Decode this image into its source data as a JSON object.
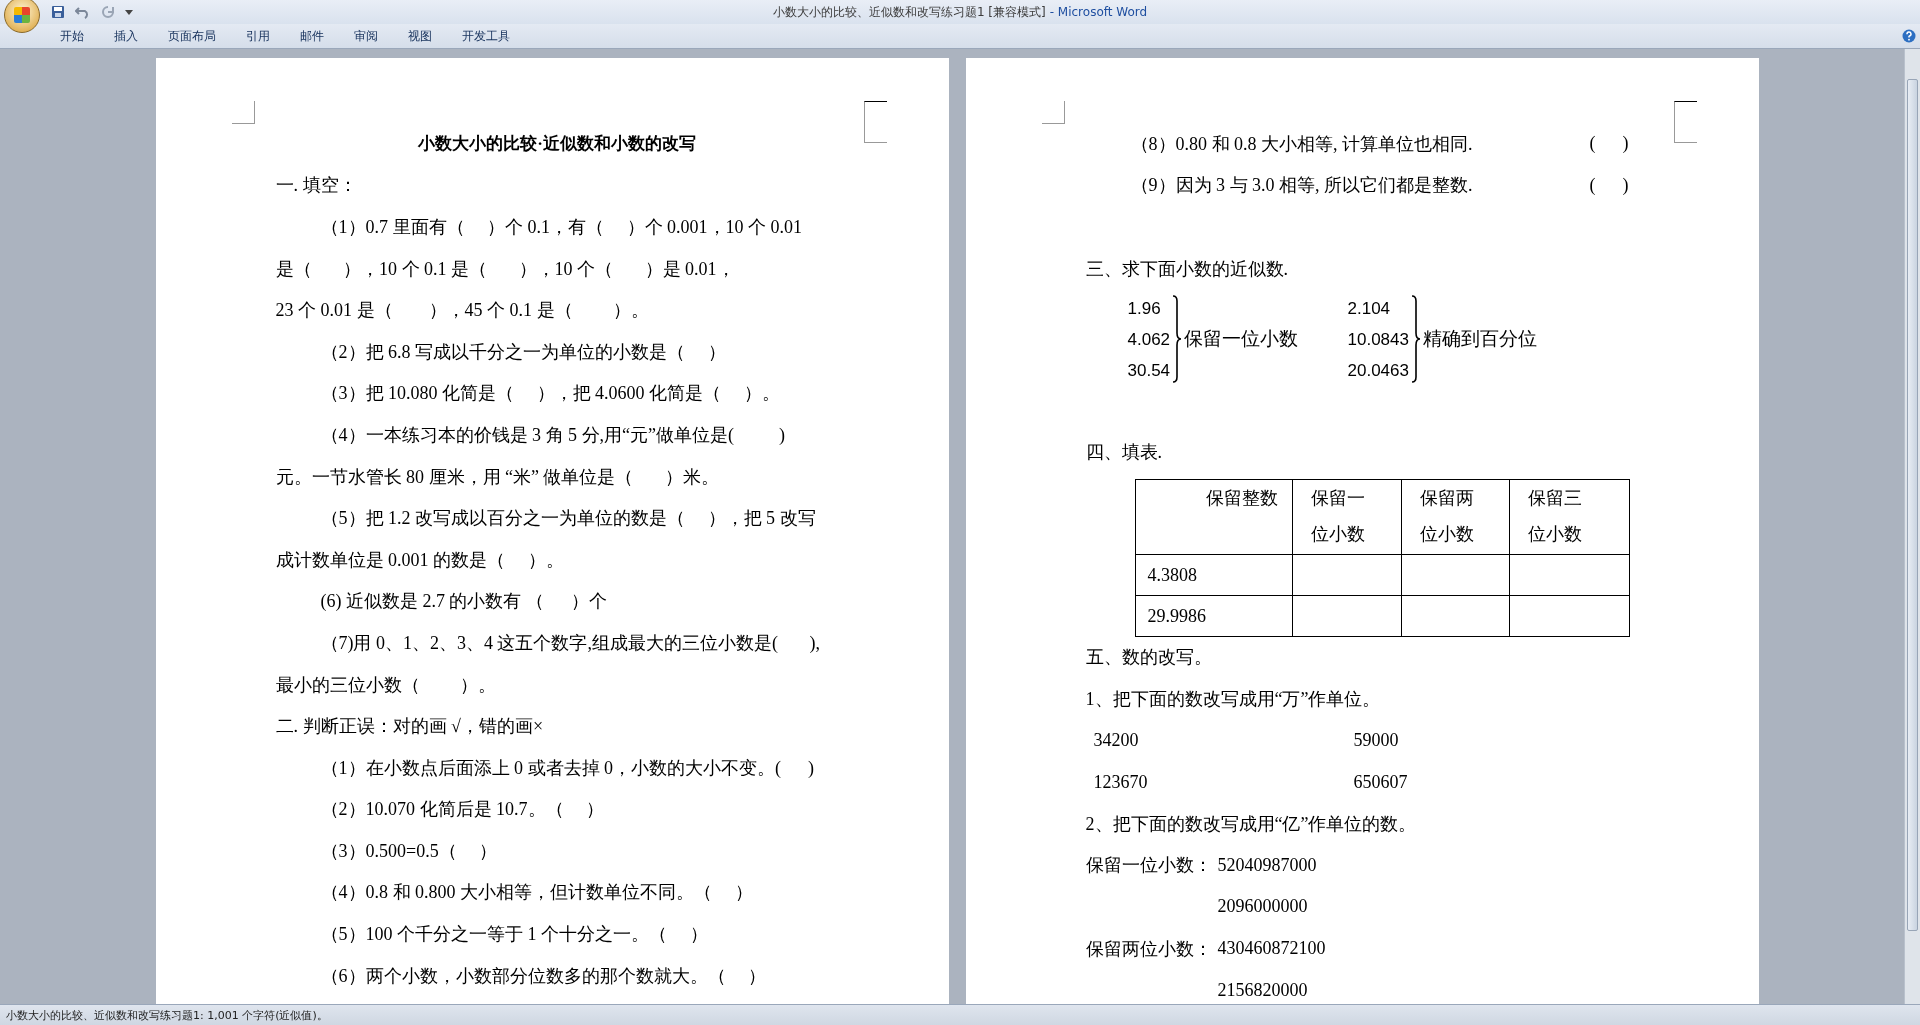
{
  "window": {
    "title": "小数大小的比较、近似数和改写练习题1 [兼容模式]",
    "app": "- Microsoft Word"
  },
  "ribbon_tabs": [
    {
      "label": "开始",
      "selected": false
    },
    {
      "label": "插入",
      "selected": false
    },
    {
      "label": "页面布局",
      "selected": false
    },
    {
      "label": "引用",
      "selected": false
    },
    {
      "label": "邮件",
      "selected": false
    },
    {
      "label": "审阅",
      "selected": false
    },
    {
      "label": "视图",
      "selected": false
    },
    {
      "label": "开发工具",
      "selected": false
    }
  ],
  "pages": [
    {
      "blocks": [
        {
          "kind": "title",
          "text": "小数大小的比较·近似数和小数的改写"
        },
        {
          "kind": "heading",
          "text": "一. 填空："
        },
        {
          "kind": "line",
          "indent": true,
          "text": "（1）0.7 里面有（     ）个 0.1，有（     ）个 0.001，10 个 0.01"
        },
        {
          "kind": "line",
          "indent": false,
          "text": "是（       ），10 个 0.1 是（       ），10 个（       ）是 0.01，"
        },
        {
          "kind": "line",
          "indent": false,
          "text": "23 个 0.01 是（        ），45 个 0.1 是（         ）。"
        },
        {
          "kind": "line",
          "indent": true,
          "text": "（2）把 6.8 写成以千分之一为单位的小数是（     ）"
        },
        {
          "kind": "line",
          "indent": true,
          "text": "（3）把 10.080 化简是（     ），把 4.0600 化简是（     ）。"
        },
        {
          "kind": "line",
          "indent": true,
          "text": "（4）一本练习本的价钱是 3 角 5 分,用“元”做单位是(          )"
        },
        {
          "kind": "line",
          "indent": false,
          "text": "元。一节水管长 80 厘米，用 “米” 做单位是（       ）米。"
        },
        {
          "kind": "line",
          "indent": true,
          "text": "（5）把 1.2 改写成以百分之一为单位的数是（     ），把 5 改写"
        },
        {
          "kind": "line",
          "indent": false,
          "text": "成计数单位是 0.001 的数是（     ）。"
        },
        {
          "kind": "line",
          "indent": true,
          "text": "(6) 近似数是 2.7 的小数有 （      ）个"
        },
        {
          "kind": "line",
          "indent": true,
          "text": "（7)用 0、1、2、3、4 这五个数字,组成最大的三位小数是(       ),"
        },
        {
          "kind": "line",
          "indent": false,
          "text": "最小的三位小数（         ）。"
        },
        {
          "kind": "heading",
          "text": "二. 判断正误：对的画 √，错的画×"
        },
        {
          "kind": "line",
          "indent": true,
          "text": "（1）在小数点后面添上 0 或者去掉 0，小数的大小不变。(      )"
        },
        {
          "kind": "line",
          "indent": true,
          "text": "（2）10.070 化简后是 10.7。（     ）"
        },
        {
          "kind": "line",
          "indent": true,
          "text": "（3）0.500=0.5（     ）"
        },
        {
          "kind": "line",
          "indent": true,
          "text": "（4）0.8 和 0.800 大小相等，但计数单位不同。（     ）"
        },
        {
          "kind": "line",
          "indent": true,
          "text": "（5）100 个千分之一等于 1 个十分之一。（     ）"
        },
        {
          "kind": "line",
          "indent": true,
          "text": "（6）两个小数，小数部分位数多的那个数就大。（     ）"
        }
      ]
    },
    {
      "blocks": [
        {
          "kind": "tab_line",
          "text": "（8）0.80 和 0.8 大小相等, 计算单位也相同.",
          "answer": "(      )"
        },
        {
          "kind": "tab_line",
          "text": "（9）因为 3 与 3.0 相等, 所以它们都是整数.",
          "answer": "(      )"
        },
        {
          "kind": "blank"
        },
        {
          "kind": "heading",
          "text": "三、求下面小数的近似数."
        },
        {
          "kind": "brace",
          "groups": [
            {
              "numbers": [
                "1.96",
                "4.062",
                "30.54"
              ],
              "label": "保留一位小数"
            },
            {
              "numbers": [
                "2.104",
                "10.0843",
                "20.0463"
              ],
              "label": "精确到百分位"
            }
          ]
        },
        {
          "kind": "blank"
        },
        {
          "kind": "heading",
          "text": "四、填表."
        },
        {
          "kind": "table",
          "columns": [
            [
              "保留整数"
            ],
            [
              "保留一",
              "位小数"
            ],
            [
              "保留两",
              "位小数"
            ],
            [
              "保留三",
              "位小数"
            ]
          ],
          "rows": [
            "4.3808",
            "29.9986"
          ]
        },
        {
          "kind": "heading",
          "text": "五、数的改写。"
        },
        {
          "kind": "heading",
          "text": "1、把下面的数改写成用“万”作单位。"
        },
        {
          "kind": "pair",
          "values": [
            "34200",
            "59000"
          ]
        },
        {
          "kind": "pair",
          "values": [
            "123670",
            "650607"
          ]
        },
        {
          "kind": "heading",
          "text": "2、把下面的数改写成用“亿”作单位的数。"
        },
        {
          "kind": "labeled",
          "label": "保留一位小数：",
          "value": "52040987000"
        },
        {
          "kind": "labeled",
          "value": "2096000000"
        },
        {
          "kind": "labeled",
          "label": "保留两位小数：",
          "value": "430460872100"
        },
        {
          "kind": "labeled",
          "value": "2156820000"
        }
      ]
    }
  ],
  "status_bar": {
    "text": "小数大小的比较、近似数和改写练习题1: 1,001 个字符(近似值)。"
  }
}
